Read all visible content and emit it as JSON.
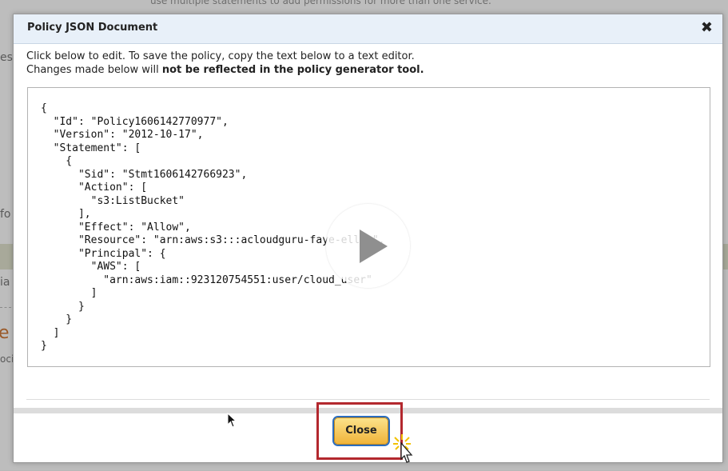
{
  "background": {
    "top_line": "use multiple statements to add permissions for more than one service.",
    "fragments": [
      "es",
      "fo",
      "ia",
      "oci"
    ],
    "orange_fragment": "e"
  },
  "modal": {
    "title": "Policy JSON Document",
    "close_icon": "close-icon",
    "intro_line1": "Click below to edit. To save the policy, copy the text below to a text editor.",
    "intro_line2_prefix": "Changes made below will ",
    "intro_line2_bold": "not be reflected in the policy generator tool.",
    "policy_text": "{\n  \"Id\": \"Policy1606142770977\",\n  \"Version\": \"2012-10-17\",\n  \"Statement\": [\n    {\n      \"Sid\": \"Stmt1606142766923\",\n      \"Action\": [\n        \"s3:ListBucket\"\n      ],\n      \"Effect\": \"Allow\",\n      \"Resource\": \"arn:aws:s3:::acloudguru-faye-ellis\",\n      \"Principal\": {\n        \"AWS\": [\n          \"arn:aws:iam::923120754551:user/cloud_user\"\n        ]\n      }\n    }\n  ]\n}",
    "close_button_label": "Close"
  },
  "overlay": {
    "play_icon": "play-icon",
    "accent_highlight": "#b3282e"
  }
}
